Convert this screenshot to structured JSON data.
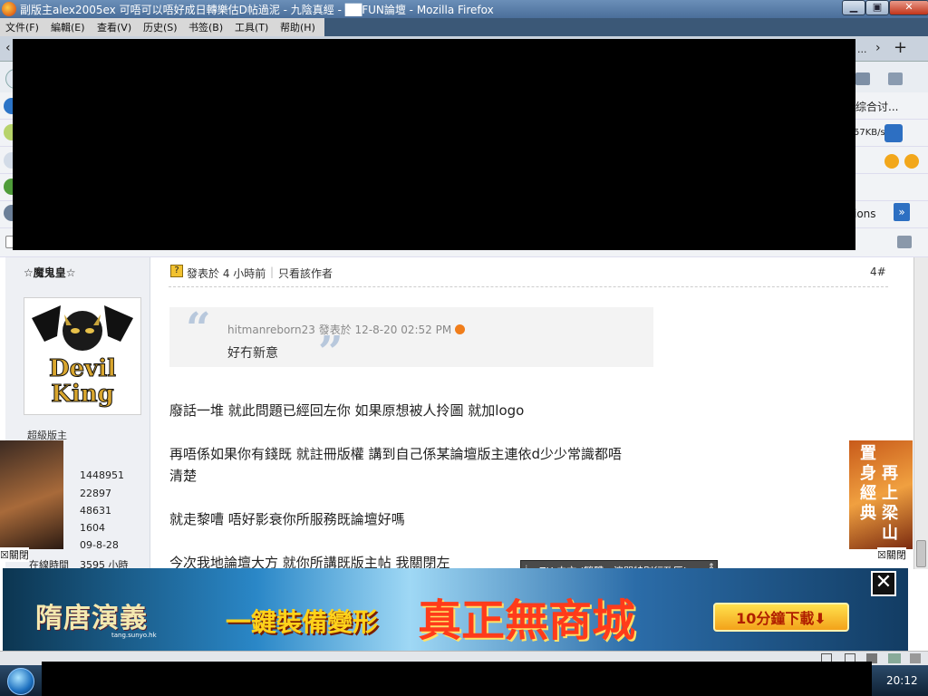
{
  "window": {
    "title": "副版主alex2005ex 可唔可以唔好成日轉樂估D帖過泥 - 九陰真經 - ██FUN論壇 - Mozilla Firefox",
    "minimize_label": "▁",
    "maximize_label": "▣",
    "close_label": "✕"
  },
  "menu": {
    "items": [
      "文件(F)",
      "編輯(E)",
      "查看(V)",
      "历史(S)",
      "书签(B)",
      "工具(T)",
      "帮助(H)"
    ]
  },
  "tabstrip": {
    "overflow_label": "...",
    "new_tab_label": "+",
    "scroll_left": "‹",
    "scroll_right": "›"
  },
  "toolbar": {
    "bookmark_fragment": "综合讨...",
    "speed": "57KB/s",
    "options_fragment": "ions",
    "overflow": "»"
  },
  "post": {
    "author_name": "☆魔鬼皇☆",
    "rank": "超級版主",
    "stats": [
      "1448951",
      "22897",
      "48631",
      "1604",
      "09-8-28",
      "3595 小時"
    ],
    "online_label": "在線時間",
    "posted_at": "發表於 4 小時前",
    "only_author": "只看該作者",
    "floor": "4#",
    "quote": {
      "author": "hitmanreborn23",
      "posted": "發表於 12-8-20 02:52 PM",
      "text": "好冇新意"
    },
    "body": [
      "廢話一堆 就此問題已經回左你 如果原想被人拎圖 就加logo",
      "再唔係如果你有錢既 就註冊版權 講到自己係某論壇版主連依d少少常識都唔",
      "清楚",
      "就走黎嘈 唔好影衰你所服務既論壇好嗎",
      "今次我地論壇大方 就你所講既版主帖 我關閉左"
    ]
  },
  "floating_ads": {
    "close_label": "☒關閉",
    "right_text": [
      "置身經典",
      "再上梁山"
    ]
  },
  "ime": {
    "label": "ZH 中文 (繁體，澳門特別行政區)"
  },
  "banner": {
    "logo": "隋唐演義",
    "logo_sub": "tang.sunyo.hk",
    "slogan1": "一鍵裝備變形",
    "slogan2": "真正無商城",
    "download": "10分鐘下載⬇",
    "close": "✕"
  },
  "taskbar": {
    "clock": "20:12"
  },
  "avatar_text": "Devil King",
  "colors": {
    "banner_red": "#ff3b1a",
    "banner_gold": "#ffd21a",
    "sidebar_bg": "#eef0f4",
    "quote_bg": "#f3f3f3"
  }
}
